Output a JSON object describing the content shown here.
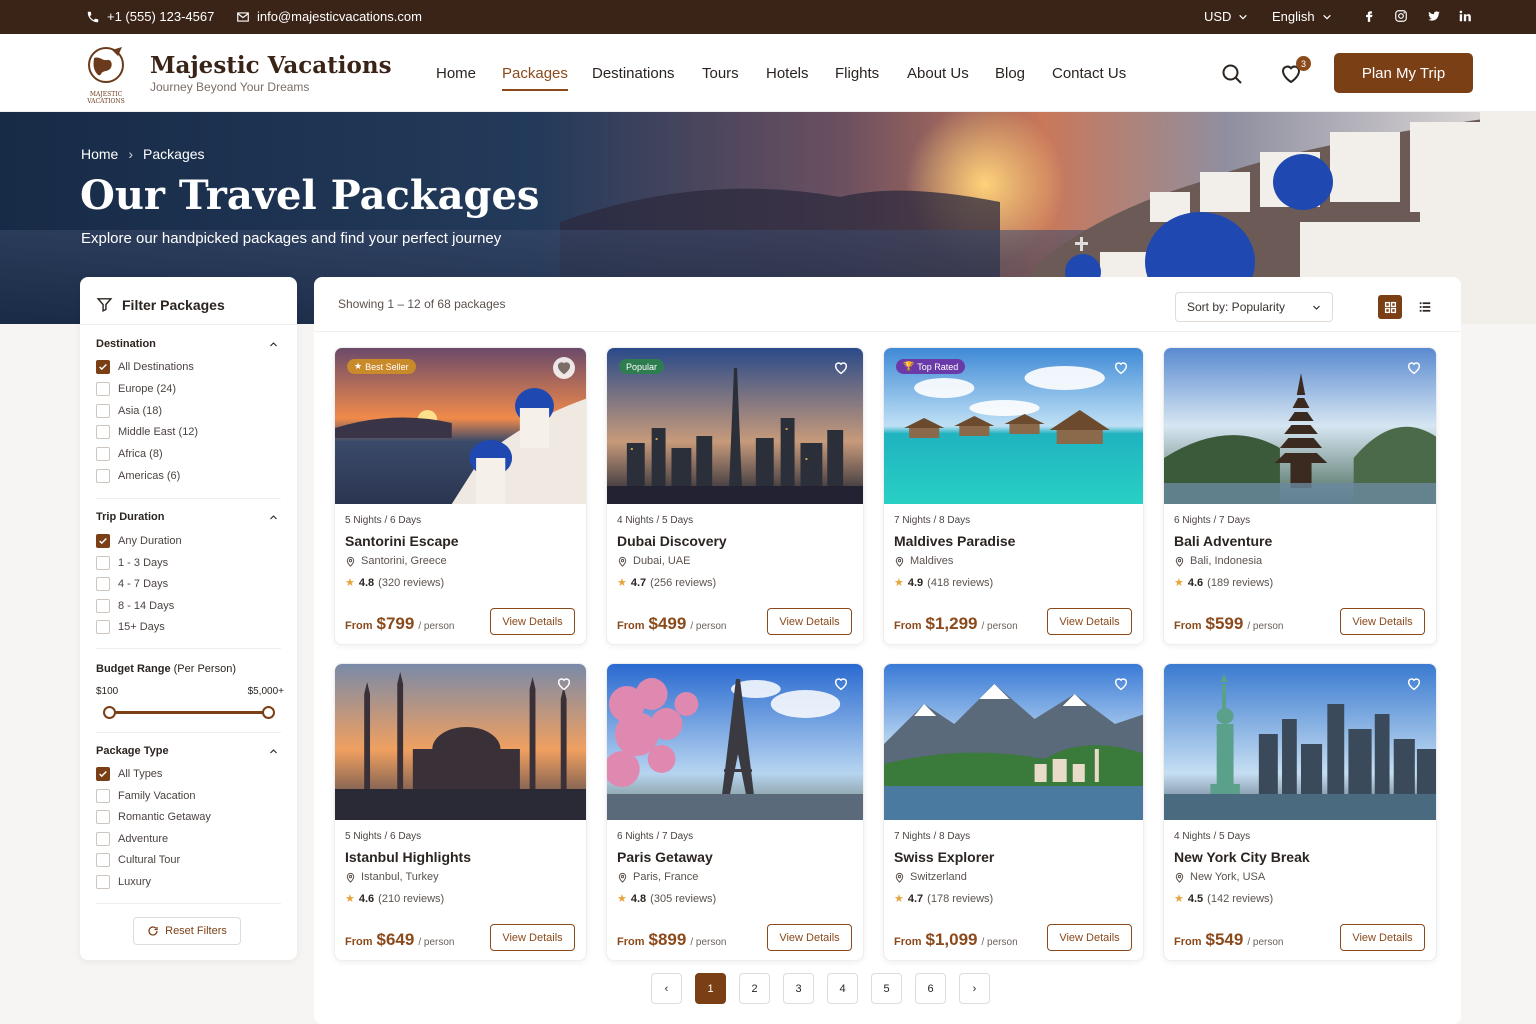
{
  "topbar": {
    "phone": "+1 (555) 123-4567",
    "email": "info@majesticvacations.com",
    "currency": "USD",
    "language": "English"
  },
  "brand": {
    "name": "Majestic Vacations",
    "tagline": "Journey Beyond Your Dreams",
    "logo_text": "MAJESTIC VACATIONS"
  },
  "nav": [
    "Home",
    "Packages",
    "Destinations",
    "Tours",
    "Hotels",
    "Flights",
    "About Us",
    "Blog",
    "Contact Us"
  ],
  "nav_active": "Packages",
  "wishlist_count": "3",
  "plan_button": "Plan My Trip",
  "hero": {
    "breadcrumb": [
      "Home",
      "Packages"
    ],
    "title": "Our Travel Packages",
    "subtitle": "Explore our handpicked packages and find your perfect journey"
  },
  "filters": {
    "title": "Filter Packages",
    "destination": {
      "label": "Destination",
      "options": [
        "All Destinations",
        "Europe (24)",
        "Asia (18)",
        "Middle East (12)",
        "Africa (8)",
        "Americas (6)"
      ],
      "checked": "All Destinations"
    },
    "duration": {
      "label": "Trip Duration",
      "options": [
        "Any Duration",
        "1 - 3 Days",
        "4 - 7 Days",
        "8 - 14 Days",
        "15+ Days"
      ],
      "checked": "Any Duration"
    },
    "budget": {
      "label": "Budget Range",
      "label_suffix": "(Per Person)",
      "min": "$100",
      "max": "$5,000+"
    },
    "type": {
      "label": "Package Type",
      "options": [
        "All Types",
        "Family Vacation",
        "Romantic Getaway",
        "Adventure",
        "Cultural Tour",
        "Luxury"
      ],
      "checked": "All Types"
    },
    "reset": "Reset Filters"
  },
  "results": {
    "showing": "Showing 1 – 12 of 68 packages",
    "sort": "Sort by: Popularity"
  },
  "packages": [
    {
      "tag": "Best Seller",
      "duration": "5 Nights / 6 Days",
      "title": "Santorini Escape",
      "location": "Santorini, Greece",
      "rating": "4.8",
      "reviews": "(320 reviews)",
      "from": "From",
      "price": "$799",
      "per": "/ person",
      "button": "View Details"
    },
    {
      "tag": "Popular",
      "duration": "4 Nights / 5 Days",
      "title": "Dubai Discovery",
      "location": "Dubai, UAE",
      "rating": "4.7",
      "reviews": "(256 reviews)",
      "from": "From",
      "price": "$499",
      "per": "/ person",
      "button": "View Details"
    },
    {
      "tag": "Top Rated",
      "duration": "7 Nights / 8 Days",
      "title": "Maldives Paradise",
      "location": "Maldives",
      "rating": "4.9",
      "reviews": "(418 reviews)",
      "from": "From",
      "price": "$1,299",
      "per": "/ person",
      "button": "View Details"
    },
    {
      "tag": "",
      "duration": "6 Nights / 7 Days",
      "title": "Bali Adventure",
      "location": "Bali, Indonesia",
      "rating": "4.6",
      "reviews": "(189 reviews)",
      "from": "From",
      "price": "$599",
      "per": "/ person",
      "button": "View Details"
    },
    {
      "tag": "",
      "duration": "5 Nights / 6 Days",
      "title": "Istanbul Highlights",
      "location": "Istanbul, Turkey",
      "rating": "4.6",
      "reviews": "(210 reviews)",
      "from": "From",
      "price": "$649",
      "per": "/ person",
      "button": "View Details"
    },
    {
      "tag": "",
      "duration": "6 Nights / 7 Days",
      "title": "Paris Getaway",
      "location": "Paris, France",
      "rating": "4.8",
      "reviews": "(305 reviews)",
      "from": "From",
      "price": "$899",
      "per": "/ person",
      "button": "View Details"
    },
    {
      "tag": "",
      "duration": "7 Nights / 8 Days",
      "title": "Swiss Explorer",
      "location": "Switzerland",
      "rating": "4.7",
      "reviews": "(178 reviews)",
      "from": "From",
      "price": "$1,099",
      "per": "/ person",
      "button": "View Details"
    },
    {
      "tag": "",
      "duration": "4 Nights / 5 Days",
      "title": "New York City Break",
      "location": "New York, USA",
      "rating": "4.5",
      "reviews": "(142 reviews)",
      "from": "From",
      "price": "$549",
      "per": "/ person",
      "button": "View Details"
    }
  ],
  "pagination": {
    "pages": [
      "1",
      "2",
      "3",
      "4",
      "5",
      "6"
    ],
    "current": "1",
    "prev": "‹",
    "next": "›"
  },
  "colors": {
    "brand": "#7b3f16",
    "topbar": "#3a2418",
    "star": "#e8a33d"
  }
}
